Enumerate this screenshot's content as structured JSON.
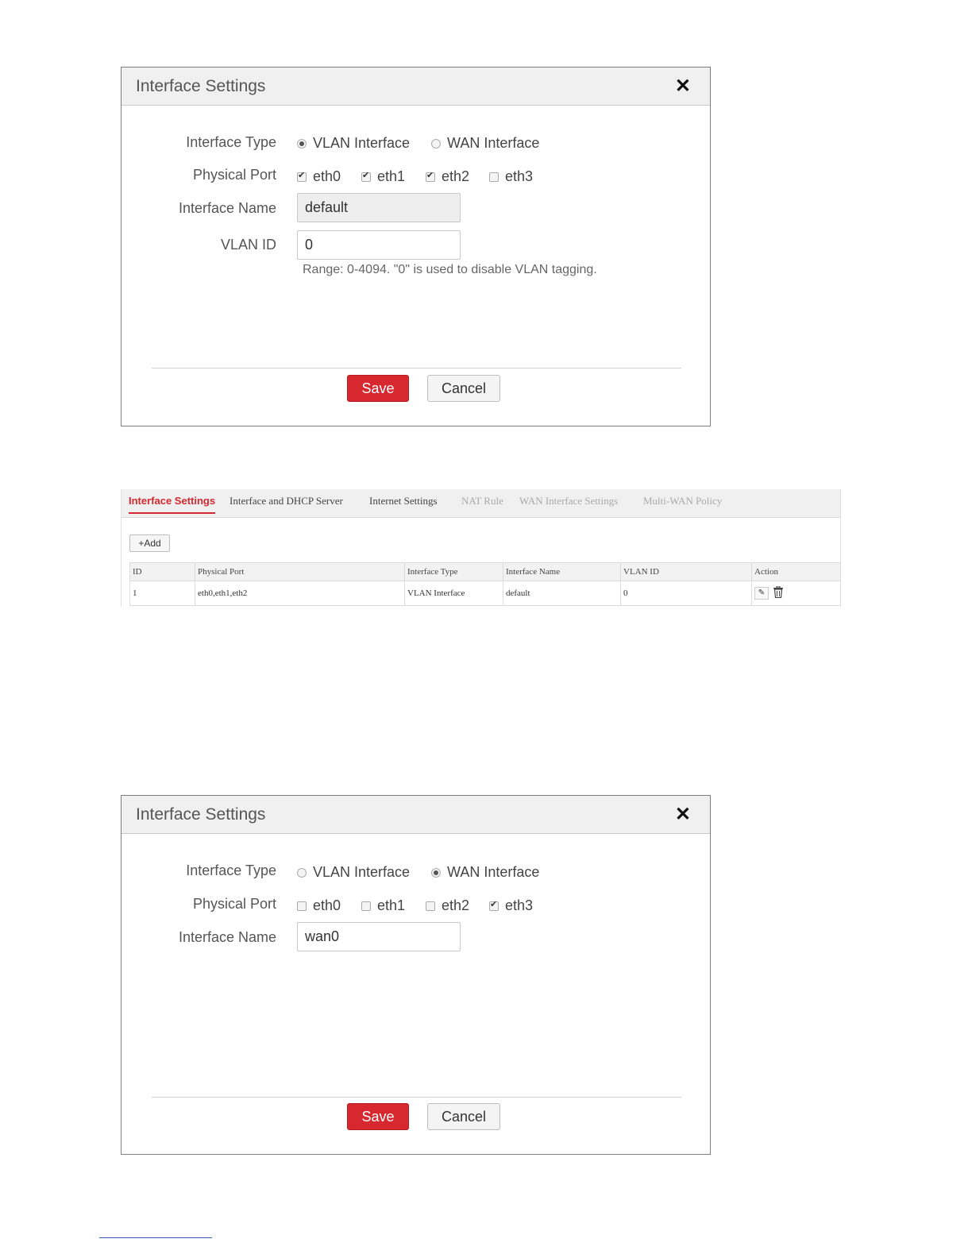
{
  "dialog1": {
    "title": "Interface Settings",
    "interface_type_label": "Interface Type",
    "interface_types": [
      {
        "label": "VLAN Interface",
        "selected": true
      },
      {
        "label": "WAN Interface",
        "selected": false
      }
    ],
    "physical_port_label": "Physical Port",
    "ports": [
      {
        "label": "eth0",
        "checked": true
      },
      {
        "label": "eth1",
        "checked": true
      },
      {
        "label": "eth2",
        "checked": true
      },
      {
        "label": "eth3",
        "checked": false
      }
    ],
    "interface_name_label": "Interface Name",
    "interface_name_value": "default",
    "vlan_id_label": "VLAN ID",
    "vlan_id_value": "0",
    "vlan_hint": "Range: 0-4094. \"0\" is used to disable VLAN tagging.",
    "save_label": "Save",
    "cancel_label": "Cancel"
  },
  "panel": {
    "tabs": [
      {
        "label": "Interface Settings",
        "state": "active"
      },
      {
        "label": "Interface and DHCP Server",
        "state": "normal"
      },
      {
        "label": "Internet Settings",
        "state": "normal"
      },
      {
        "label": "NAT Rule",
        "state": "disabled"
      },
      {
        "label": "WAN Interface Settings",
        "state": "disabled"
      },
      {
        "label": "Multi-WAN Policy",
        "state": "disabled"
      }
    ],
    "add_label": "+Add",
    "columns": [
      "ID",
      "Physical Port",
      "Interface Type",
      "Interface Name",
      "VLAN ID",
      "Action"
    ],
    "rows": [
      {
        "id": "1",
        "physical_port": "eth0,eth1,eth2",
        "interface_type": "VLAN Interface",
        "interface_name": "default",
        "vlan_id": "0"
      }
    ]
  },
  "dialog2": {
    "title": "Interface Settings",
    "interface_type_label": "Interface Type",
    "interface_types": [
      {
        "label": "VLAN Interface",
        "selected": false
      },
      {
        "label": "WAN Interface",
        "selected": true
      }
    ],
    "physical_port_label": "Physical Port",
    "ports": [
      {
        "label": "eth0",
        "checked": false
      },
      {
        "label": "eth1",
        "checked": false
      },
      {
        "label": "eth2",
        "checked": false
      },
      {
        "label": "eth3",
        "checked": true
      }
    ],
    "interface_name_label": "Interface Name",
    "interface_name_value": "wan0",
    "save_label": "Save",
    "cancel_label": "Cancel"
  },
  "colors": {
    "accent": "#d7272f",
    "disabled_tab": "#aaaaaa"
  }
}
